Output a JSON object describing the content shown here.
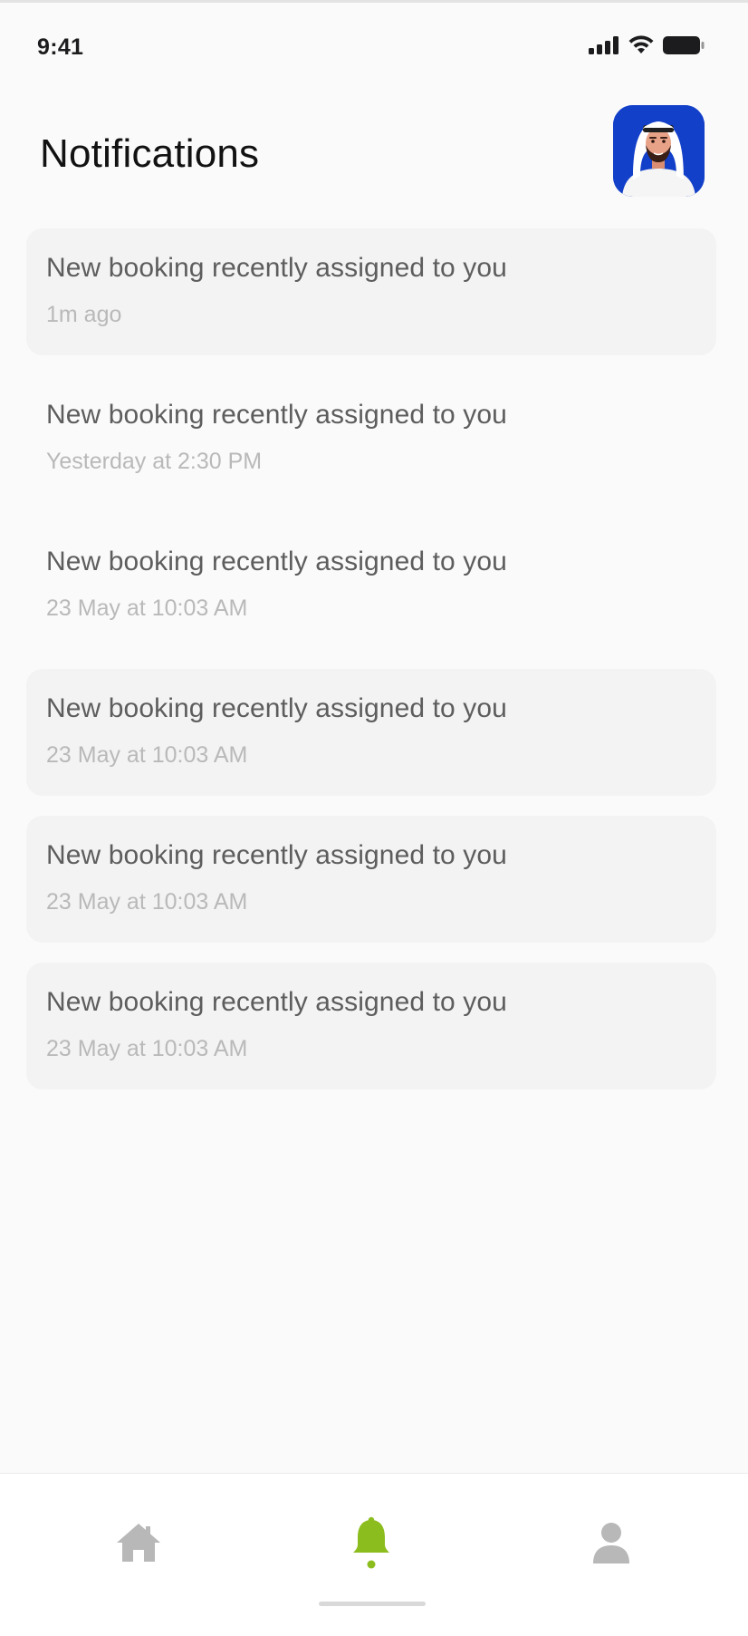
{
  "status_bar": {
    "time": "9:41",
    "icons": [
      "signal-icon",
      "wifi-icon",
      "battery-icon"
    ]
  },
  "header": {
    "title": "Notifications",
    "avatar": "user-avatar"
  },
  "notifications": [
    {
      "message": "New booking recently assigned to you",
      "time": "1m ago",
      "style": "shaded"
    },
    {
      "message": "New booking recently assigned to you",
      "time": "Yesterday at 2:30 PM",
      "style": "plain"
    },
    {
      "message": "New booking recently assigned to you",
      "time": "23 May at 10:03 AM",
      "style": "plain"
    },
    {
      "message": "New booking recently assigned to you",
      "time": "23 May at 10:03 AM",
      "style": "shaded"
    },
    {
      "message": "New booking recently assigned to you",
      "time": "23 May at 10:03 AM",
      "style": "shaded"
    },
    {
      "message": "New booking recently assigned to you",
      "time": "23 May at 10:03 AM",
      "style": "shaded"
    }
  ],
  "bottom_nav": {
    "items": [
      {
        "name": "home",
        "icon": "home-icon",
        "active": false
      },
      {
        "name": "notifications",
        "icon": "bell-icon",
        "active": true
      },
      {
        "name": "profile",
        "icon": "person-icon",
        "active": false
      }
    ]
  },
  "colors": {
    "accent": "#8cbd1e",
    "inactive_icon": "#b8b8b8",
    "avatar_bg": "#1340c9",
    "card_bg": "#f3f3f3",
    "page_bg": "#fafafa"
  }
}
